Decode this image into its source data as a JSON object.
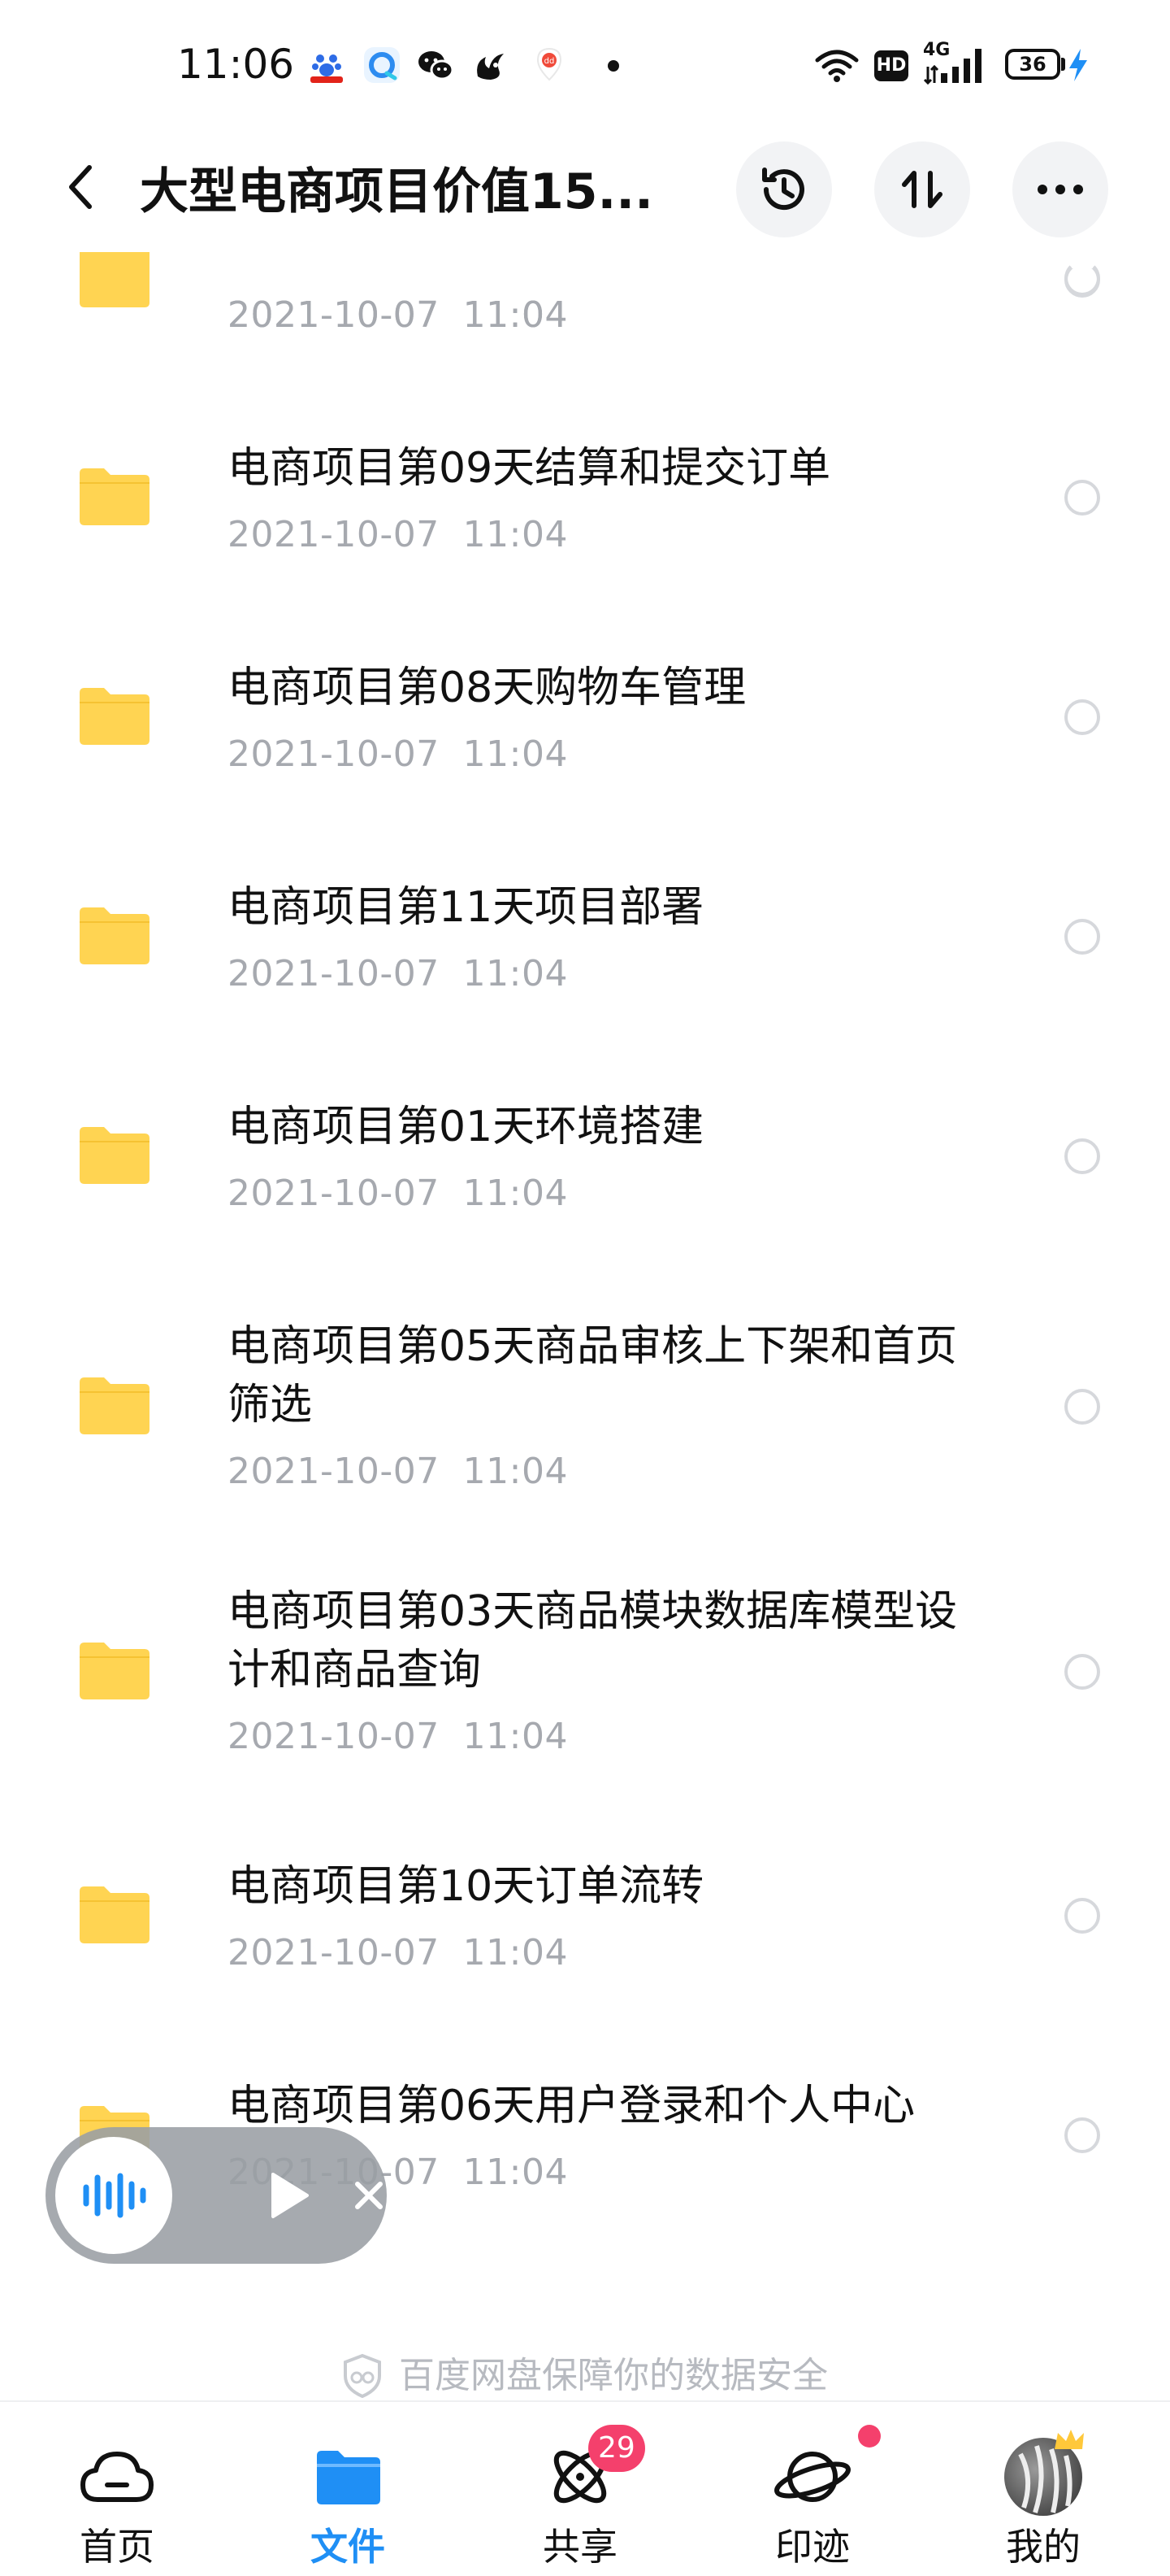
{
  "status_bar": {
    "time": "11:06",
    "battery_level": "36",
    "network": "4G",
    "hd_label": "HD",
    "app_icons": [
      "baidu-icon",
      "browser-icon",
      "wechat-icon",
      "uc-icon",
      "map-pin-icon"
    ]
  },
  "header": {
    "title": "大型电商项目价值15..."
  },
  "files": [
    {
      "name": "",
      "date": "2021-10-07  11:04"
    },
    {
      "name": "电商项目第09天结算和提交订单",
      "date": "2021-10-07  11:04"
    },
    {
      "name": "电商项目第08天购物车管理",
      "date": "2021-10-07  11:04"
    },
    {
      "name": "电商项目第11天项目部署",
      "date": "2021-10-07  11:04"
    },
    {
      "name": "电商项目第01天环境搭建",
      "date": "2021-10-07  11:04"
    },
    {
      "name": "电商项目第05天商品审核上下架和首页筛选",
      "date": "2021-10-07  11:04"
    },
    {
      "name": "电商项目第03天商品模块数据库模型设计和商品查询",
      "date": "2021-10-07  11:04"
    },
    {
      "name": "电商项目第10天订单流转",
      "date": "2021-10-07  11:04"
    },
    {
      "name": "电商项目第06天用户登录和个人中心",
      "date": "2021-10-07  11:04"
    }
  ],
  "security_note": "百度网盘保障你的数据安全",
  "bottom_nav": [
    {
      "label": "首页",
      "icon": "cloud-icon",
      "active": false
    },
    {
      "label": "文件",
      "icon": "folder-icon",
      "active": true
    },
    {
      "label": "共享",
      "icon": "atom-icon",
      "active": false,
      "badge": "29"
    },
    {
      "label": "印迹",
      "icon": "planet-icon",
      "active": false,
      "dot": true
    },
    {
      "label": "我的",
      "icon": "avatar",
      "active": false
    }
  ],
  "colors": {
    "accent": "#1f8ff5",
    "folder": "#ffd452",
    "badge": "#f4406c",
    "date_text": "#a6a9af",
    "radio_border": "#d6d8dc"
  }
}
